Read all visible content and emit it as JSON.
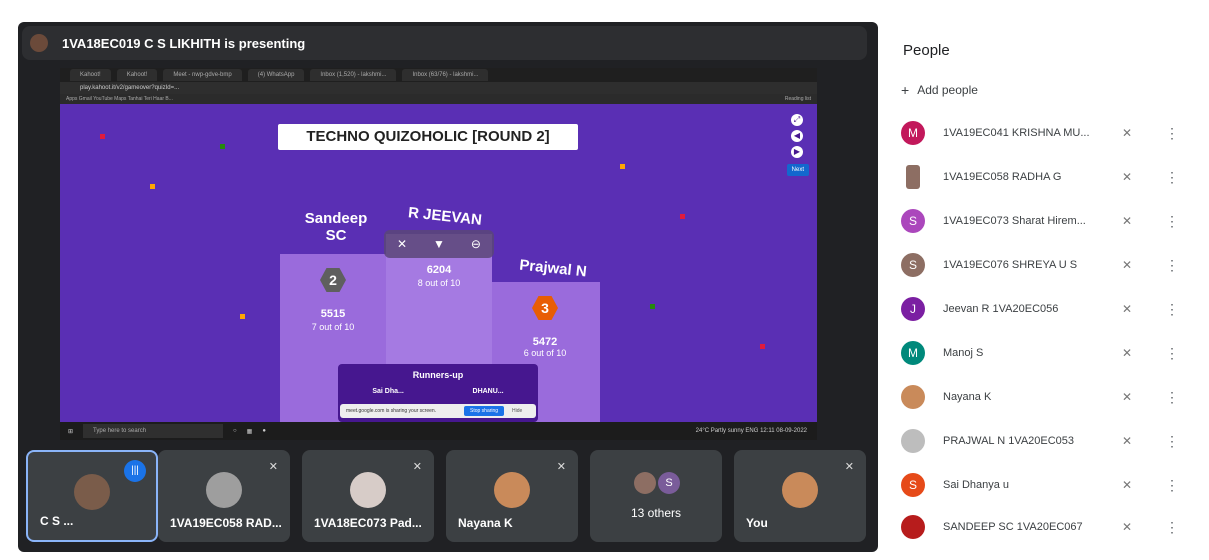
{
  "presenter": {
    "text": "1VA18EC019 C S LIKHITH is presenting"
  },
  "browser": {
    "tabs": [
      "Kahoot!",
      "Kahoot!",
      "Meet - nwp-gdve-bmp",
      "(4) WhatsApp",
      "Inbox (1,520) - lakshmi...",
      "Inbox (63/76) - lakshmi..."
    ],
    "address": "play.kahoot.it/v2/gameover?quizId=...",
    "bookmarks": "Apps  Gmail  YouTube  Maps  Tanhai Teri Haar B...",
    "reading_list": "Reading list"
  },
  "kahoot": {
    "title": "TECHNO QUIZOHOLIC [ROUND 2]",
    "next_label": "Next",
    "first": {
      "name": "R JEEVAN",
      "score": "6204",
      "detail": "8 out of 10"
    },
    "second": {
      "name": "Sandeep SC",
      "score": "5515",
      "detail": "7 out of 10",
      "rank": "2"
    },
    "third": {
      "name": "Prajwal N",
      "score": "5472",
      "detail": "6 out of 10",
      "rank": "3"
    },
    "runners_up": "Runners-up",
    "runner_names": [
      "Sai Dha...",
      "DHANU..."
    ],
    "sharing_notice": "meet.google.com is sharing your screen.",
    "stop_sharing": "Stop sharing",
    "hide": "Hide"
  },
  "taskbar": {
    "search": "Type here to search",
    "tray": "24°C Partly sunny  ENG 12:11 08-09-2022"
  },
  "tiles": [
    {
      "name": "C S ...",
      "speaking": true
    },
    {
      "name": "1VA19EC058 RAD...",
      "muted": true
    },
    {
      "name": "1VA18EC073 Pad...",
      "muted": true
    },
    {
      "name": "Nayana K",
      "muted": true
    },
    {
      "name": "13 others",
      "avatar_letter": "S"
    },
    {
      "name": "You",
      "muted": true
    }
  ],
  "panel": {
    "title": "People",
    "add_people": "Add people",
    "people": [
      {
        "name": "1VA19EC041 KRISHNA MU...",
        "letter": "M",
        "color": "#c2185b"
      },
      {
        "name": "1VA19EC058 RADHA G",
        "letter": "",
        "color": "#8d6e63"
      },
      {
        "name": "1VA19EC073 Sharat Hirem...",
        "letter": "S",
        "color": "#ab47bc"
      },
      {
        "name": "1VA19EC076 SHREYA U S",
        "letter": "S",
        "color": "#8d6e63"
      },
      {
        "name": "Jeevan R 1VA20EC056",
        "letter": "J",
        "color": "#7b1fa2"
      },
      {
        "name": "Manoj S",
        "letter": "M",
        "color": "#00897b"
      },
      {
        "name": "Nayana K",
        "letter": "",
        "color": "#c98a5a"
      },
      {
        "name": "PRAJWAL N 1VA20EC053",
        "letter": "",
        "color": "#bdbdbd"
      },
      {
        "name": "Sai Dhanya u",
        "letter": "S",
        "color": "#e64a19"
      },
      {
        "name": "SANDEEP SC 1VA20EC067",
        "letter": "",
        "color": "#b71c1c"
      }
    ]
  },
  "colors": {
    "kahoot_purple": "#5a2fb4",
    "meet_dark": "#202124",
    "accent_blue": "#1a73e8"
  }
}
